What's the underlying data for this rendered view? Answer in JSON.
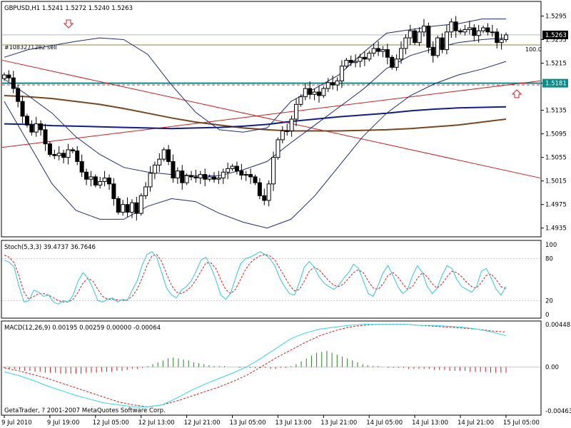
{
  "colors": {
    "background": "#ffffff",
    "candle": "#000000",
    "bollinger": "#1f2d73",
    "ma_blue": "#0f1f8a",
    "ma_brown": "#7a4620",
    "trendline_red": "#cc1d1d",
    "horizontal_teal": "#0d8a8a",
    "level_dashed": "#c04040",
    "level_olive": "#8a8a3a",
    "stoch_main": "#2fc7d8",
    "stoch_signal": "#d11c1c",
    "macd_line": "#2fd7e8",
    "macd_signal": "#d11c1c",
    "macd_hist_pos": "#1f8a1f",
    "macd_hist_neg": "#d11c1c",
    "price_box": "#000000",
    "teal_box": "#0d8a8a"
  },
  "main": {
    "title": "GBPUSD,H1  1.5241 1.5272 1.5240 1.5263",
    "order_label": "#1083271282 sell",
    "level_label": "100.0",
    "current_price_label": "1.5263",
    "horizontal_price_label": "1.5181",
    "arrow_down_icon": "down-arrow-icon",
    "arrow_up_icon": "up-arrow-icon"
  },
  "stoch_panel": {
    "title": "Stoch(5,3,3) 39.4737 36.7646",
    "scale": [
      "100",
      "80",
      "20",
      "0"
    ]
  },
  "macd_panel": {
    "title": "MACD(12,26,9) 0.00195 0.00259 0.00000 -0.00064",
    "scale": [
      "0.00448",
      "0.00",
      "-0.00463"
    ]
  },
  "watermark": "GetaTrader, ? 2001-2007 MetaQuotes Software Corp.",
  "chart_data": [
    {
      "type": "candlestick",
      "title": "GBPUSD,H1  1.5241 1.5272 1.5240 1.5263",
      "y_ticks": [
        1.5295,
        1.5255,
        1.5215,
        1.5181,
        1.5135,
        1.5095,
        1.5055,
        1.5015,
        1.4975,
        1.4935
      ],
      "y_tick_labels": [
        "1.5295",
        "1.5255",
        "1.5215",
        "1.5181",
        "1.5135",
        "1.5095",
        "1.5055",
        "1.5015",
        "1.4975",
        "1.4935"
      ],
      "ylim": [
        1.4925,
        1.5315
      ],
      "x_tick_labels": [
        "9 Jul 2010",
        "9 Jul 19:00",
        "12 Jul 05:00",
        "12 Jul 13:00",
        "12 Jul 21:00",
        "13 Jul 05:00",
        "13 Jul 13:00",
        "13 Jul 21:00",
        "14 Jul 05:00",
        "14 Jul 13:00",
        "14 Jul 21:00",
        "15 Jul 05:00"
      ],
      "current_price": 1.5263,
      "horizontal_level": 1.5181,
      "order_level": 1.5246,
      "dashed_level": 1.5178,
      "closes": [
        1.5195,
        1.519,
        1.5172,
        1.515,
        1.5125,
        1.511,
        1.5098,
        1.5112,
        1.5102,
        1.5078,
        1.506,
        1.5058,
        1.5062,
        1.5055,
        1.5068,
        1.5066,
        1.5048,
        1.503,
        1.5018,
        1.5022,
        1.5008,
        1.5014,
        1.502,
        1.501,
        1.4985,
        1.4962,
        1.4975,
        1.4962,
        1.4978,
        1.496,
        1.499,
        1.5005,
        1.5028,
        1.5042,
        1.5052,
        1.5068,
        1.5048,
        1.502,
        1.5032,
        1.5012,
        1.5024,
        1.5022,
        1.502,
        1.5026,
        1.5018,
        1.5022,
        1.5018,
        1.502,
        1.503,
        1.5036,
        1.504,
        1.5032,
        1.5025,
        1.5026,
        1.5022,
        1.5012,
        1.499,
        1.4982,
        1.501,
        1.5055,
        1.5085,
        1.51,
        1.51,
        1.512,
        1.5145,
        1.5158,
        1.5172,
        1.5162,
        1.5166,
        1.516,
        1.5172,
        1.5182,
        1.5178,
        1.5185,
        1.521,
        1.522,
        1.5216,
        1.5218,
        1.5225,
        1.5222,
        1.5232,
        1.524,
        1.5235,
        1.5238,
        1.5225,
        1.5208,
        1.5222,
        1.524,
        1.5258,
        1.527,
        1.525,
        1.5268,
        1.5278,
        1.5242,
        1.5228,
        1.5258,
        1.5238,
        1.5268,
        1.5285,
        1.527,
        1.5268,
        1.5272,
        1.5275,
        1.5262,
        1.527,
        1.5275,
        1.5268,
        1.5268,
        1.525,
        1.5255,
        1.5263
      ],
      "bollinger_upper": [
        1.5225,
        1.5238,
        1.5245,
        1.5252,
        1.5258,
        1.5255,
        1.523,
        1.5178,
        1.5132,
        1.5102,
        1.5098,
        1.5105,
        1.515,
        1.5172,
        1.5195,
        1.5232,
        1.5266,
        1.5272,
        1.5278,
        1.5282,
        1.529,
        1.529
      ],
      "bollinger_middle": [
        1.5188,
        1.516,
        1.513,
        1.509,
        1.506,
        1.5038,
        1.503,
        1.5026,
        1.5024,
        1.5024,
        1.5034,
        1.5048,
        1.508,
        1.511,
        1.514,
        1.517,
        1.5206,
        1.5228,
        1.524,
        1.525,
        1.5255,
        1.5258
      ],
      "bollinger_lower": [
        1.515,
        1.508,
        1.501,
        1.4965,
        1.495,
        1.495,
        1.4972,
        1.4985,
        1.498,
        1.496,
        1.4945,
        1.4935,
        1.495,
        1.499,
        1.504,
        1.509,
        1.513,
        1.516,
        1.518,
        1.5195,
        1.5205,
        1.5218
      ],
      "ma_blue": [
        1.5112,
        1.5111,
        1.5109,
        1.5108,
        1.5107,
        1.5106,
        1.5105,
        1.5104,
        1.5105,
        1.5106,
        1.5108,
        1.5111,
        1.5116,
        1.512,
        1.5124,
        1.5127,
        1.513,
        1.5134,
        1.5137,
        1.5139,
        1.514,
        1.5141
      ],
      "ma_brown": [
        1.516,
        1.5158,
        1.5155,
        1.515,
        1.5145,
        1.5138,
        1.513,
        1.5122,
        1.5115,
        1.511,
        1.5105,
        1.5102,
        1.51,
        1.51,
        1.51,
        1.5101,
        1.5102,
        1.5104,
        1.5107,
        1.511,
        1.5115,
        1.512
      ],
      "trendline_down": [
        [
          0,
          1.522
        ],
        [
          1.0,
          1.502
        ]
      ],
      "trendline_up": [
        [
          0,
          1.5072
        ],
        [
          1.0,
          1.5185
        ]
      ]
    },
    {
      "type": "line",
      "title": "Stoch(5,3,3) 39.4737 36.7646",
      "ylim": [
        0,
        100
      ],
      "levels": [
        80,
        20
      ],
      "series": [
        {
          "name": "Stoch(5,3,3)",
          "values": [
            78,
            75,
            68,
            40,
            18,
            20,
            35,
            32,
            26,
            28,
            18,
            15,
            20,
            18,
            28,
            48,
            60,
            52,
            38,
            20,
            18,
            22,
            24,
            18,
            22,
            20,
            35,
            48,
            70,
            86,
            90,
            82,
            60,
            38,
            28,
            24,
            35,
            40,
            48,
            62,
            78,
            82,
            68,
            50,
            28,
            22,
            30,
            52,
            72,
            80,
            82,
            86,
            90,
            86,
            80,
            70,
            52,
            40,
            30,
            28,
            46,
            68,
            76,
            68,
            54,
            45,
            40,
            36,
            42,
            52,
            60,
            72,
            66,
            48,
            30,
            26,
            42,
            60,
            70,
            56,
            40,
            30,
            36,
            56,
            70,
            60,
            40,
            30,
            38,
            56,
            70,
            66,
            50,
            40,
            36,
            32,
            40,
            62,
            66,
            52,
            36,
            28,
            40
          ]
        },
        {
          "name": "signal",
          "values": [
            85,
            82,
            74,
            55,
            32,
            22,
            26,
            30,
            30,
            28,
            24,
            20,
            18,
            18,
            22,
            32,
            45,
            52,
            48,
            36,
            26,
            22,
            22,
            21,
            20,
            21,
            26,
            36,
            52,
            70,
            84,
            86,
            76,
            58,
            42,
            32,
            30,
            34,
            40,
            50,
            62,
            74,
            74,
            66,
            50,
            36,
            30,
            36,
            50,
            64,
            74,
            80,
            84,
            86,
            84,
            78,
            66,
            54,
            42,
            34,
            36,
            48,
            62,
            68,
            64,
            56,
            48,
            42,
            40,
            44,
            52,
            60,
            64,
            60,
            48,
            38,
            36,
            44,
            56,
            60,
            54,
            44,
            36,
            40,
            52,
            60,
            54,
            44,
            38,
            44,
            54,
            62,
            60,
            54,
            46,
            40,
            38,
            46,
            56,
            58,
            50,
            40,
            37
          ]
        }
      ]
    },
    {
      "type": "bar",
      "title": "MACD(12,26,9) 0.00195 0.00259 0.00000 -0.00064",
      "ylim": [
        -0.00463,
        0.00448
      ],
      "histogram": [
        -0.0001,
        -0.0002,
        -0.0002,
        -0.0003,
        -0.0004,
        -0.0004,
        -0.0005,
        -0.0005,
        -0.0006,
        -0.0006,
        -0.0006,
        -0.0007,
        -0.0007,
        -0.0007,
        -0.0007,
        -0.0007,
        -0.0006,
        -0.0006,
        -0.0006,
        -0.0005,
        -0.0005,
        -0.0005,
        -0.0004,
        -0.0004,
        -0.0003,
        -0.0002,
        -0.0002,
        -0.0001,
        0.0001,
        0.0003,
        0.0005,
        0.0007,
        0.0009,
        0.001,
        0.0009,
        0.0008,
        0.0007,
        0.0005,
        0.0004,
        0.0003,
        0.0002,
        0.0001,
        0.0001,
        0.0001,
        0.0,
        0.0,
        -0.0001,
        -0.0001,
        -0.0001,
        -0.0001,
        -0.0001,
        -0.0001,
        -0.0002,
        -0.0002,
        -0.0001,
        -0.0001,
        0.0001,
        0.0003,
        0.0006,
        0.0009,
        0.0012,
        0.0015,
        0.0016,
        0.0017,
        0.0015,
        0.0013,
        0.0011,
        0.0009,
        0.0007,
        0.0005,
        0.0003,
        0.0002,
        0.0001,
        0.0001,
        0.0,
        -0.0001,
        -0.0001,
        -0.0001,
        -0.0001,
        -0.0002,
        -0.0002,
        -0.0002,
        -0.0002,
        -0.0002,
        -0.0003,
        -0.0003,
        -0.0003,
        -0.0004,
        -0.0004,
        -0.0004,
        -0.0004,
        -0.0005,
        -0.0005,
        -0.0005,
        -0.0005,
        -0.0006,
        -0.0006,
        -0.0006,
        -0.0006
      ],
      "series": [
        {
          "name": "MACD",
          "values": [
            -0.0005,
            -0.0009,
            -0.0014,
            -0.002,
            -0.0025,
            -0.003,
            -0.0034,
            -0.0038,
            -0.004,
            -0.0042,
            -0.0042,
            -0.004,
            -0.0033,
            -0.0025,
            -0.0018,
            -0.0012,
            -0.0006,
            0.0001,
            0.001,
            0.002,
            0.003,
            0.0036,
            0.004,
            0.0042,
            0.0044,
            0.0045,
            0.0045,
            0.0045,
            0.0045,
            0.0044,
            0.0044,
            0.0043,
            0.0042,
            0.004,
            0.0037,
            0.0033
          ]
        },
        {
          "name": "signal",
          "values": [
            -0.0001,
            -0.0004,
            -0.0008,
            -0.0012,
            -0.0017,
            -0.0022,
            -0.0027,
            -0.0032,
            -0.0037,
            -0.004,
            -0.0042,
            -0.004,
            -0.0036,
            -0.0031,
            -0.0026,
            -0.0021,
            -0.0015,
            -0.0008,
            0.0001,
            0.001,
            0.0018,
            0.0026,
            0.0033,
            0.0038,
            0.0042,
            0.0044,
            0.0045,
            0.0045,
            0.0045,
            0.0044,
            0.0043,
            0.0042,
            0.0041,
            0.004,
            0.0038,
            0.0037
          ]
        }
      ]
    }
  ]
}
